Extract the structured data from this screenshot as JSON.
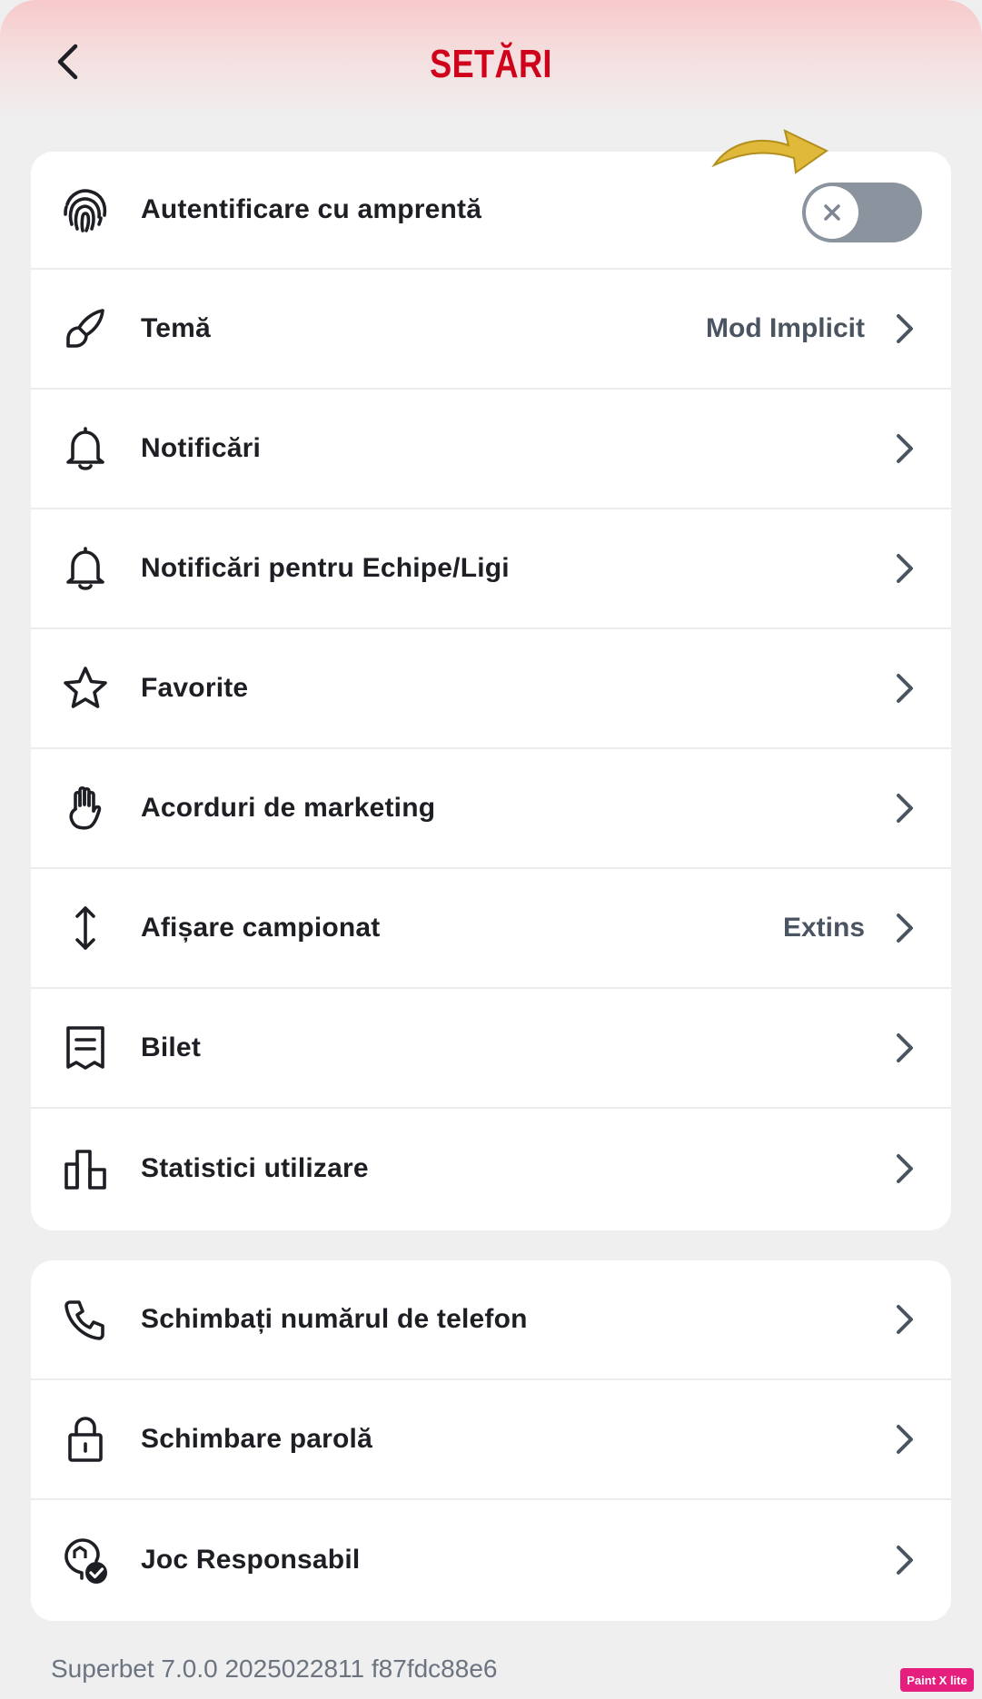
{
  "header": {
    "title": "SETĂRI",
    "back_icon": "chevron-left-icon"
  },
  "settings_primary": [
    {
      "name": "fingerprint",
      "icon": "fingerprint-icon",
      "label": "Autentificare cu amprentă",
      "toggle": false
    },
    {
      "name": "theme",
      "icon": "brush-icon",
      "label": "Temă",
      "value": "Mod Implicit"
    },
    {
      "name": "notifications",
      "icon": "bell-icon",
      "label": "Notificări"
    },
    {
      "name": "team-notifications",
      "icon": "bell-icon",
      "label": "Notificări pentru Echipe/Ligi"
    },
    {
      "name": "favorites",
      "icon": "star-icon",
      "label": "Favorite"
    },
    {
      "name": "marketing",
      "icon": "hand-icon",
      "label": "Acorduri de marketing"
    },
    {
      "name": "championship-display",
      "icon": "vertical-arrows-icon",
      "label": "Afișare campionat",
      "value": "Extins"
    },
    {
      "name": "ticket",
      "icon": "receipt-icon",
      "label": "Bilet"
    },
    {
      "name": "usage-stats",
      "icon": "bar-chart-icon",
      "label": "Statistici utilizare"
    }
  ],
  "settings_account": [
    {
      "name": "change-phone",
      "icon": "phone-icon",
      "label": "Schimbați numărul de telefon"
    },
    {
      "name": "change-password",
      "icon": "lock-icon",
      "label": "Schimbare parolă"
    },
    {
      "name": "responsible-gaming",
      "icon": "responsible-gaming-icon",
      "label": "Joc Responsabil"
    }
  ],
  "footer": {
    "version": "Superbet 7.0.0 2025022811 f87fdc88e6"
  },
  "watermark": "Paint X lite",
  "colors": {
    "title_red": "#d0021b",
    "toggle_off": "#8a939e",
    "annotation_arrow": "#e0b93a"
  }
}
